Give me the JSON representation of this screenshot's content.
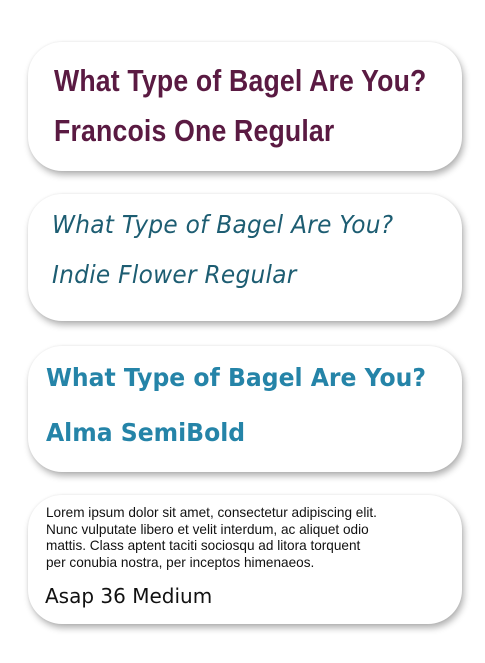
{
  "cards": [
    {
      "title": "What Type of Bagel Are You?",
      "font_name": "Francois One Regular",
      "color": "#5a1a42"
    },
    {
      "title": "What Type of Bagel Are You?",
      "font_name": "Indie Flower Regular",
      "color": "#1d5d72"
    },
    {
      "title": "What Type of Bagel Are You?",
      "font_name": "Alma SemiBold",
      "color": "#2584a8"
    },
    {
      "body": "Lorem ipsum dolor sit amet, consectetur adipiscing elit.\nNunc vulputate libero et velit interdum, ac aliquet odio\nmattis. Class aptent taciti sociosqu ad litora torquent\nper conubia nostra, per inceptos himenaeos.",
      "font_name": "Asap 36 Medium",
      "color": "#111111"
    }
  ]
}
